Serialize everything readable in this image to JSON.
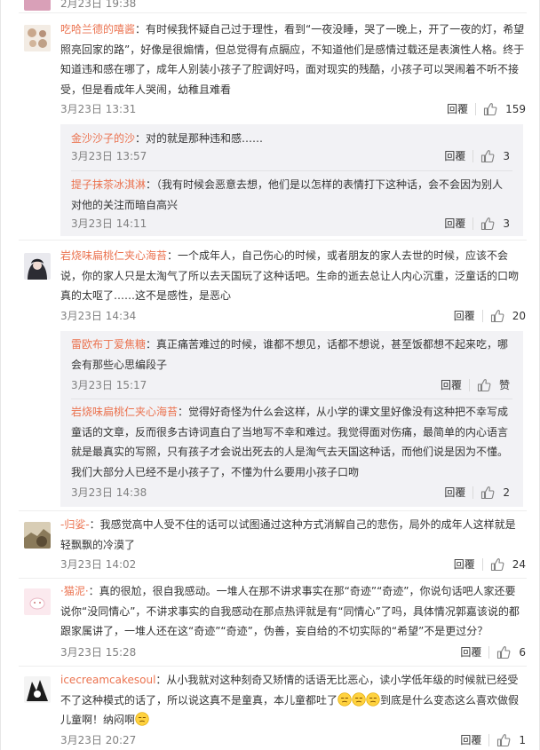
{
  "ui": {
    "reply_label": "回覆"
  },
  "top": {
    "partial_time": "2月23日 19:38"
  },
  "comments": [
    {
      "user": "吃哈兰德的嘻酱",
      "text": "：有时候我怀疑自己过于理性，看到“一夜没睡，哭了一晚上，开了一夜的灯，希望照亮回家的路”，好像是很煽情，但总觉得有点膈应，不知道他们是感情过载还是表演性人格。终于知道违和感在哪了，成年人别装小孩子了腔调好吗，面对现实的残酷，小孩子可以哭闹着不听不接受，但是看成年人哭闹，幼稚且难看",
      "time": "3月23日 13:31",
      "likes": "159",
      "replies": [
        {
          "user": "金沙沙子的沙",
          "text": "：对的就是那种违和感……",
          "time": "3月23日 13:57",
          "likes": "3"
        },
        {
          "user": "提子抹茶冰淇淋",
          "text": "：（我有时候会恶意去想，他们是以怎样的表情打下这种话，会不会因为别人对他的关注而暗自高兴",
          "time": "3月23日 14:11",
          "likes": "3"
        }
      ]
    },
    {
      "user": "岩烧味扁桃仁夹心海苔",
      "text": "：一个成年人，自己伤心的时候，或者朋友的家人去世的时候，应该不会说，你的家人只是太淘气了所以去天国玩了这种话吧。生命的逝去总让人内心沉重，泛童话的口吻真的太呕了……这不是感性，是恶心",
      "time": "3月23日 14:34",
      "likes": "20",
      "replies": [
        {
          "user": "雷欧布丁爱焦糖",
          "text": "：真正痛苦难过的时候，谁都不想见，话都不想说，甚至饭都想不起来吃，哪会有那些心思编段子",
          "time": "3月23日 15:17",
          "likes": "赞"
        },
        {
          "user": "岩烧味扁桃仁夹心海苔",
          "text": "：觉得好奇怪为什么会这样，从小学的课文里好像没有这种把不幸写成童话的文章，反而很多古诗词直白了当地写不幸和难过。我觉得面对伤痛，最简单的内心语言就是最真实的写照，只有孩子才会说出死去的人是淘气去天国这种话，而他们说是因为不懂。我们大部分人已经不是小孩子了，不懂为什么要用小孩子口吻",
          "time": "3月23日 14:38",
          "likes": "2"
        }
      ]
    },
    {
      "user": "-归娑-",
      "text": "：我感觉高中人受不住的话可以试图通过这种方式消解自己的悲伤，局外的成年人这样就是轻飘飘的冷漠了",
      "time": "3月23日 14:02",
      "likes": "24",
      "replies": []
    },
    {
      "user": "·猫泥·",
      "text": "：真的很尬，很自我感动。一堆人在那不讲求事实在那“奇迹”“奇迹”，你说句话吧人家还要说你“没同情心”，不讲求事实的自我感动在那点热评就是有“同情心”了吗，具体情况郭嘉该说的都跟家属讲了，一堆人还在这“奇迹”“奇迹”，伪善，妄自给的不切实际的“希望”不是更过分？",
      "time": "3月23日 15:28",
      "likes": "6",
      "replies": []
    },
    {
      "user": "icecreamcakesoul",
      "text_a": "：从小我就对这种刻奇又矫情的话语无比恶心，读小学低年级的时候就已经受不了这种模式的话了，所以说这真不是童真，本儿童都吐了",
      "text_b": "到底是什么变态这么喜欢做假儿童啊！纳闷啊",
      "emoji_name": "confused-emoji",
      "time": "3月23日 20:27",
      "likes": "1",
      "replies": []
    }
  ]
}
